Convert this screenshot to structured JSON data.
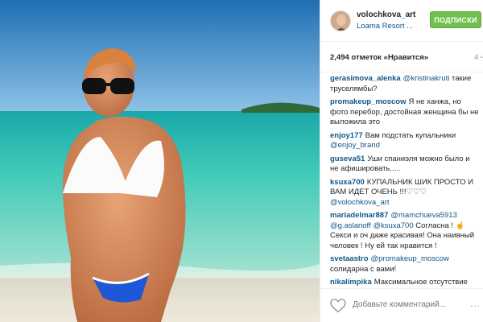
{
  "post": {
    "username": "volochkova_art",
    "location": "Loama Resort ...",
    "follow_label": "Подписки",
    "likes": "2,494 отметок «Нравится»",
    "time": "4 ч"
  },
  "comments": [
    {
      "user": "gerasimova_alenka",
      "parts": [
        {
          "mention": "@kristinakruti"
        },
        {
          "text": " такие труселямбы?"
        }
      ]
    },
    {
      "user": "promakeup_moscow",
      "parts": [
        {
          "text": "Я не ханжа, но фото перебор, достойная женщина бы не выложила это"
        }
      ]
    },
    {
      "user": "enjoy177",
      "parts": [
        {
          "text": "Вам подстать купальники "
        },
        {
          "mention": "@enjoy_brand"
        }
      ]
    },
    {
      "user": "guseva51",
      "parts": [
        {
          "text": "Уши спаниэля можно было и не афишировать....."
        }
      ]
    },
    {
      "user": "ksuxa700",
      "parts": [
        {
          "text": "КУПАЛЬНИК ШИК ПРОСТО И ВАМ ИДЕТ ОЧЕНЬ !!!♡♡♡ "
        },
        {
          "mention": "@volochkova_art"
        }
      ]
    },
    {
      "user": "mariadelmar887",
      "parts": [
        {
          "mention": "@mamchueva5913"
        },
        {
          "text": " "
        },
        {
          "mention": "@g.aslanoff"
        },
        {
          "text": " "
        },
        {
          "mention": "@ksuxa700"
        },
        {
          "text": " Согласна ! ☝ Секси и оч даже красивая! Она наивный человек ! Ну ей так нравится !"
        }
      ]
    },
    {
      "user": "svetaastro",
      "parts": [
        {
          "mention": "@promakeup_moscow"
        },
        {
          "text": " солидарна с вами!"
        }
      ]
    },
    {
      "user": "nikalimpika",
      "parts": [
        {
          "text": "Максимальное отсутствие"
        }
      ]
    }
  ],
  "footer": {
    "add_comment_placeholder": "Добавьте комментарий...",
    "more_label": "..."
  },
  "icons": {
    "like": "heart-icon",
    "more": "more-options-icon"
  }
}
